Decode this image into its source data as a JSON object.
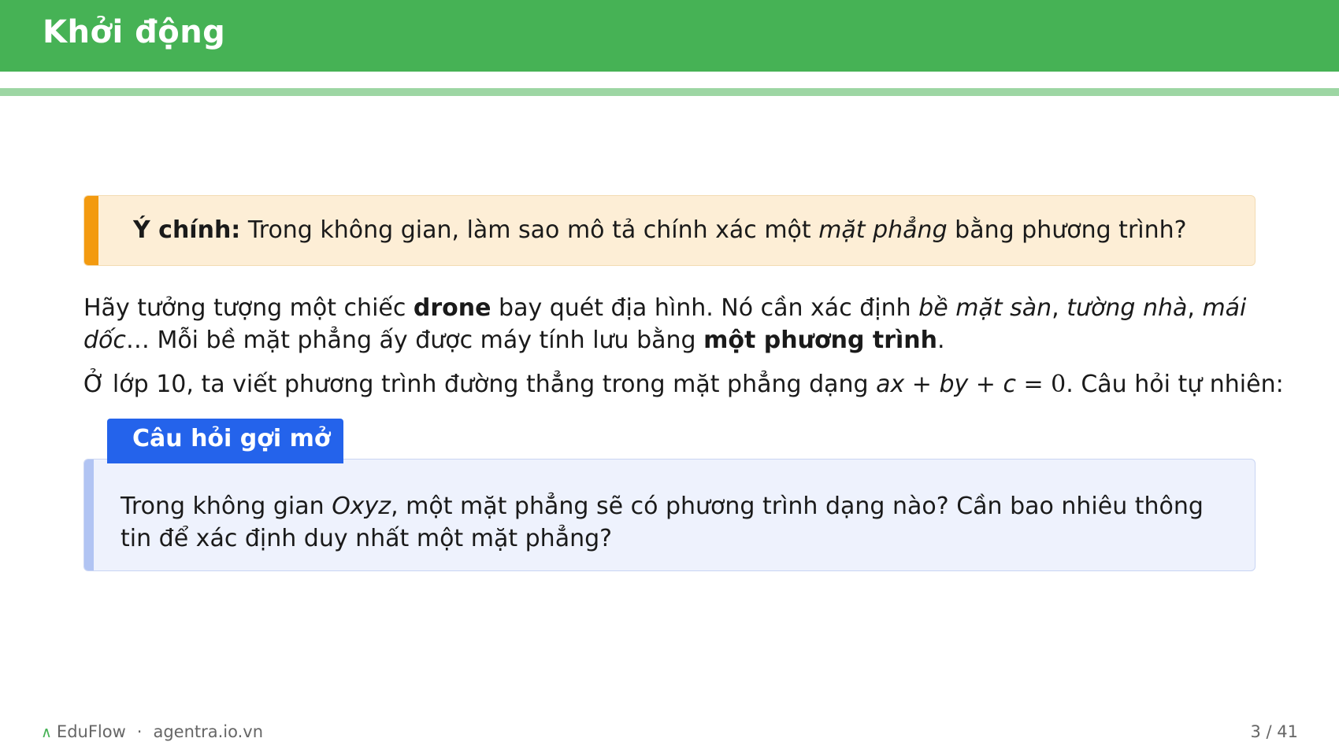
{
  "header": {
    "title": "Khởi động"
  },
  "note": {
    "label": "Ý chính:",
    "text_before": " Trong không gian, làm sao mô tả chính xác một ",
    "emphasis": "mặt phẳng",
    "text_after": " bằng phương trình?"
  },
  "paragraph1": {
    "part1": "Hãy tưởng tượng một chiếc ",
    "bold1": "drone",
    "part2": " bay quét địa hình. Nó cần xác định ",
    "italic1": "bề mặt sàn",
    "sep1": ", ",
    "italic2": "tường nhà",
    "sep2": ", ",
    "italic3": "mái dốc",
    "part3": "… Mỗi bề mặt phẳng ấy được máy tính lưu bằng ",
    "bold2": "một phương trình",
    "part4": "."
  },
  "paragraph2": {
    "text_before": "Ở lớp 10, ta viết phương trình đường thẳng trong mặt phẳng dạng ",
    "equation": {
      "a": "ax",
      "plus1": " + ",
      "b": "by",
      "plus2": " + ",
      "c": "c",
      "rhs": " = 0"
    },
    "text_after": ". Câu hỏi tự nhiên:"
  },
  "question_box": {
    "tab_label": "Câu hỏi gợi mở",
    "text_before": "Trong không gian ",
    "italic": "Oxyz",
    "text_after": ", một mặt phẳng sẽ có phương trình dạng nào? Cần bao nhiêu thông tin để xác định duy nhất một mặt phẳng?"
  },
  "footer": {
    "logo_glyph": "∧",
    "brand": "EduFlow",
    "separator": "·",
    "site": "agentra.io.vn",
    "page": "3 / 41"
  },
  "colors": {
    "header_green": "#46b255",
    "underline_green": "#9dd6a3",
    "note_accent": "#f39a0f",
    "note_bg": "#fdeed6",
    "question_tab": "#2463eb",
    "question_bg": "#eef2fd"
  }
}
